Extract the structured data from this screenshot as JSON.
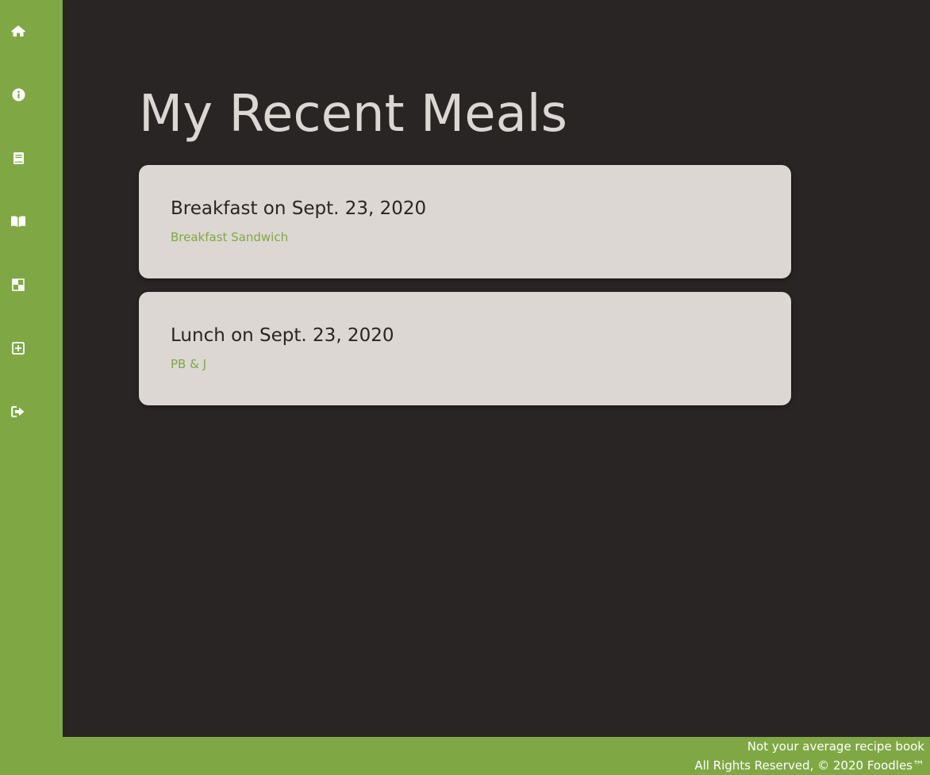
{
  "sidebar": {
    "items": [
      {
        "icon": "home-icon",
        "name": "home"
      },
      {
        "icon": "info-icon",
        "name": "about"
      },
      {
        "icon": "book-icon",
        "name": "recipes"
      },
      {
        "icon": "open-book-icon",
        "name": "recipe-book"
      },
      {
        "icon": "checkerboard-icon",
        "name": "meals"
      },
      {
        "icon": "plus-square-icon",
        "name": "add"
      },
      {
        "icon": "sign-out-icon",
        "name": "logout"
      }
    ]
  },
  "main": {
    "title": "My Recent Meals",
    "meals": [
      {
        "title": "Breakfast on Sept. 23, 2020",
        "recipe": "Breakfast Sandwich"
      },
      {
        "title": "Lunch on Sept. 23, 2020",
        "recipe": "PB & J"
      }
    ]
  },
  "footer": {
    "tagline": "Not your average recipe book",
    "copyright": "All Rights Reserved, © 2020 Foodles™"
  },
  "colors": {
    "accent": "#7fa845",
    "background": "#292524",
    "card": "#dcd7d2",
    "text_dark": "#292524",
    "footer_text": "#ffffff"
  }
}
